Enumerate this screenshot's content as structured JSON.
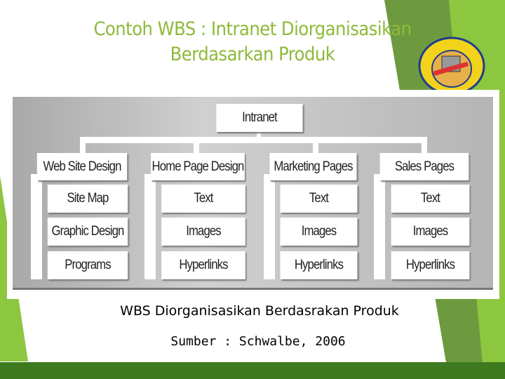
{
  "slide": {
    "title_line1": "Contoh WBS : Intranet Diorganisasikan",
    "title_line2": "Berdasarkan Produk",
    "caption": "WBS Diorganisasikan Berdasrakan Produk",
    "source": "Sumber : Schwalbe, 2006",
    "logo_text": "UNIVERSITAS KOMPUTER INDONESIA"
  },
  "wbs": {
    "root": "Intranet",
    "columns": [
      {
        "label": "Web Site Design",
        "children": [
          "Site Map",
          "Graphic Design",
          "Programs"
        ]
      },
      {
        "label": "Home Page Design",
        "children": [
          "Text",
          "Images",
          "Hyperlinks"
        ]
      },
      {
        "label": "Marketing Pages",
        "children": [
          "Text",
          "Images",
          "Hyperlinks"
        ]
      },
      {
        "label": "Sales Pages",
        "children": [
          "Text",
          "Images",
          "Hyperlinks"
        ]
      }
    ]
  },
  "colors": {
    "accent": "#8dba3a",
    "dark_green": "#3d7a1f",
    "panel": "#b8b8b8"
  }
}
